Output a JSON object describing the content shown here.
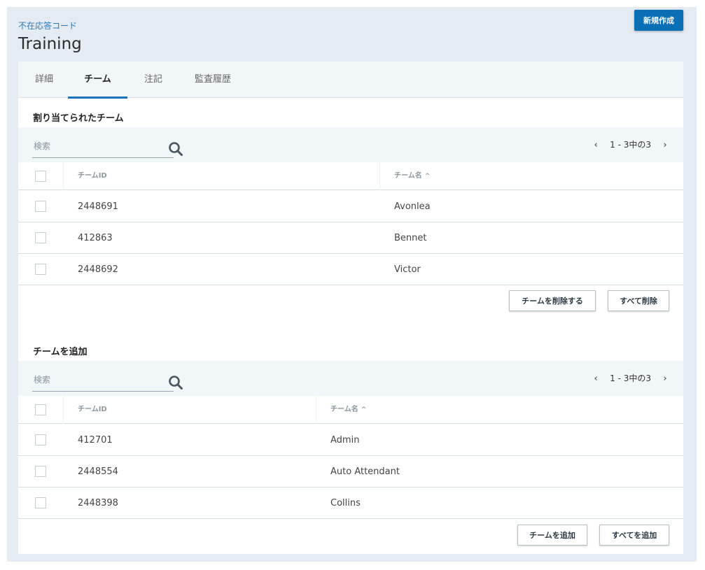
{
  "header": {
    "breadcrumb": "不在応答コード",
    "title": "Training",
    "new_button": "新規作成"
  },
  "tabs": [
    {
      "label": "詳細"
    },
    {
      "label": "チーム"
    },
    {
      "label": "注記"
    },
    {
      "label": "監査履歴"
    }
  ],
  "assigned": {
    "section_title": "割り当てられたチーム",
    "search_placeholder": "検索",
    "pager": {
      "text": "1 - 3中の3"
    },
    "columns": {
      "id": "チームID",
      "name": "チーム名"
    },
    "rows": [
      {
        "id": "2448691",
        "name": "Avonlea"
      },
      {
        "id": "412863",
        "name": "Bennet"
      },
      {
        "id": "2448692",
        "name": "Victor"
      }
    ],
    "buttons": {
      "remove": "チームを削除する",
      "remove_all": "すべて削除"
    }
  },
  "available": {
    "section_title": "チームを追加",
    "search_placeholder": "検索",
    "pager": {
      "text": "1 - 3中の3"
    },
    "columns": {
      "id": "チームID",
      "name": "チーム名"
    },
    "rows": [
      {
        "id": "412701",
        "name": "Admin"
      },
      {
        "id": "2448554",
        "name": "Auto Attendant"
      },
      {
        "id": "2448398",
        "name": "Collins"
      }
    ],
    "buttons": {
      "add": "チームを追加",
      "add_all": "すべてを追加"
    }
  },
  "icons": {
    "search": "search-icon",
    "prev": "chevron-left-icon",
    "next": "chevron-right-icon",
    "sort": "sort-ascending-icon"
  },
  "colors": {
    "accent": "#0a6fb4",
    "link": "#2a7ab8",
    "background": "#e4ebf2"
  }
}
